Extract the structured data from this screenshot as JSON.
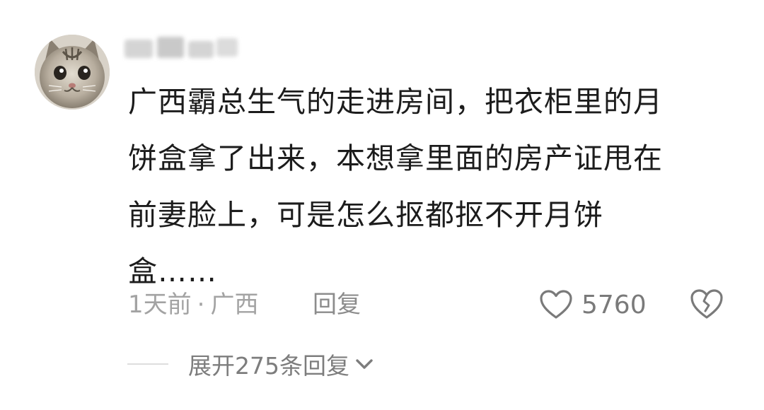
{
  "comment": {
    "body_lines": [
      "广西霸总生气的走进房间，把衣柜里的月",
      "饼盒拿了出来，本想拿里面的房产证甩在",
      "前妻脸上，可是怎么抠都抠不开月饼",
      "盒……"
    ],
    "time": "1天前",
    "separator": "·",
    "location": "广西",
    "reply_label": "回复",
    "likes": "5760",
    "expand_label": "展开275条回复"
  },
  "icons": {
    "avatar": "cat-avatar",
    "like": "heart-outline-icon",
    "dislike": "broken-heart-icon",
    "expand": "chevron-down-icon"
  },
  "colors": {
    "text": "#1c1c1c",
    "meta": "#a3a3a3",
    "action": "#7a7a7a"
  }
}
